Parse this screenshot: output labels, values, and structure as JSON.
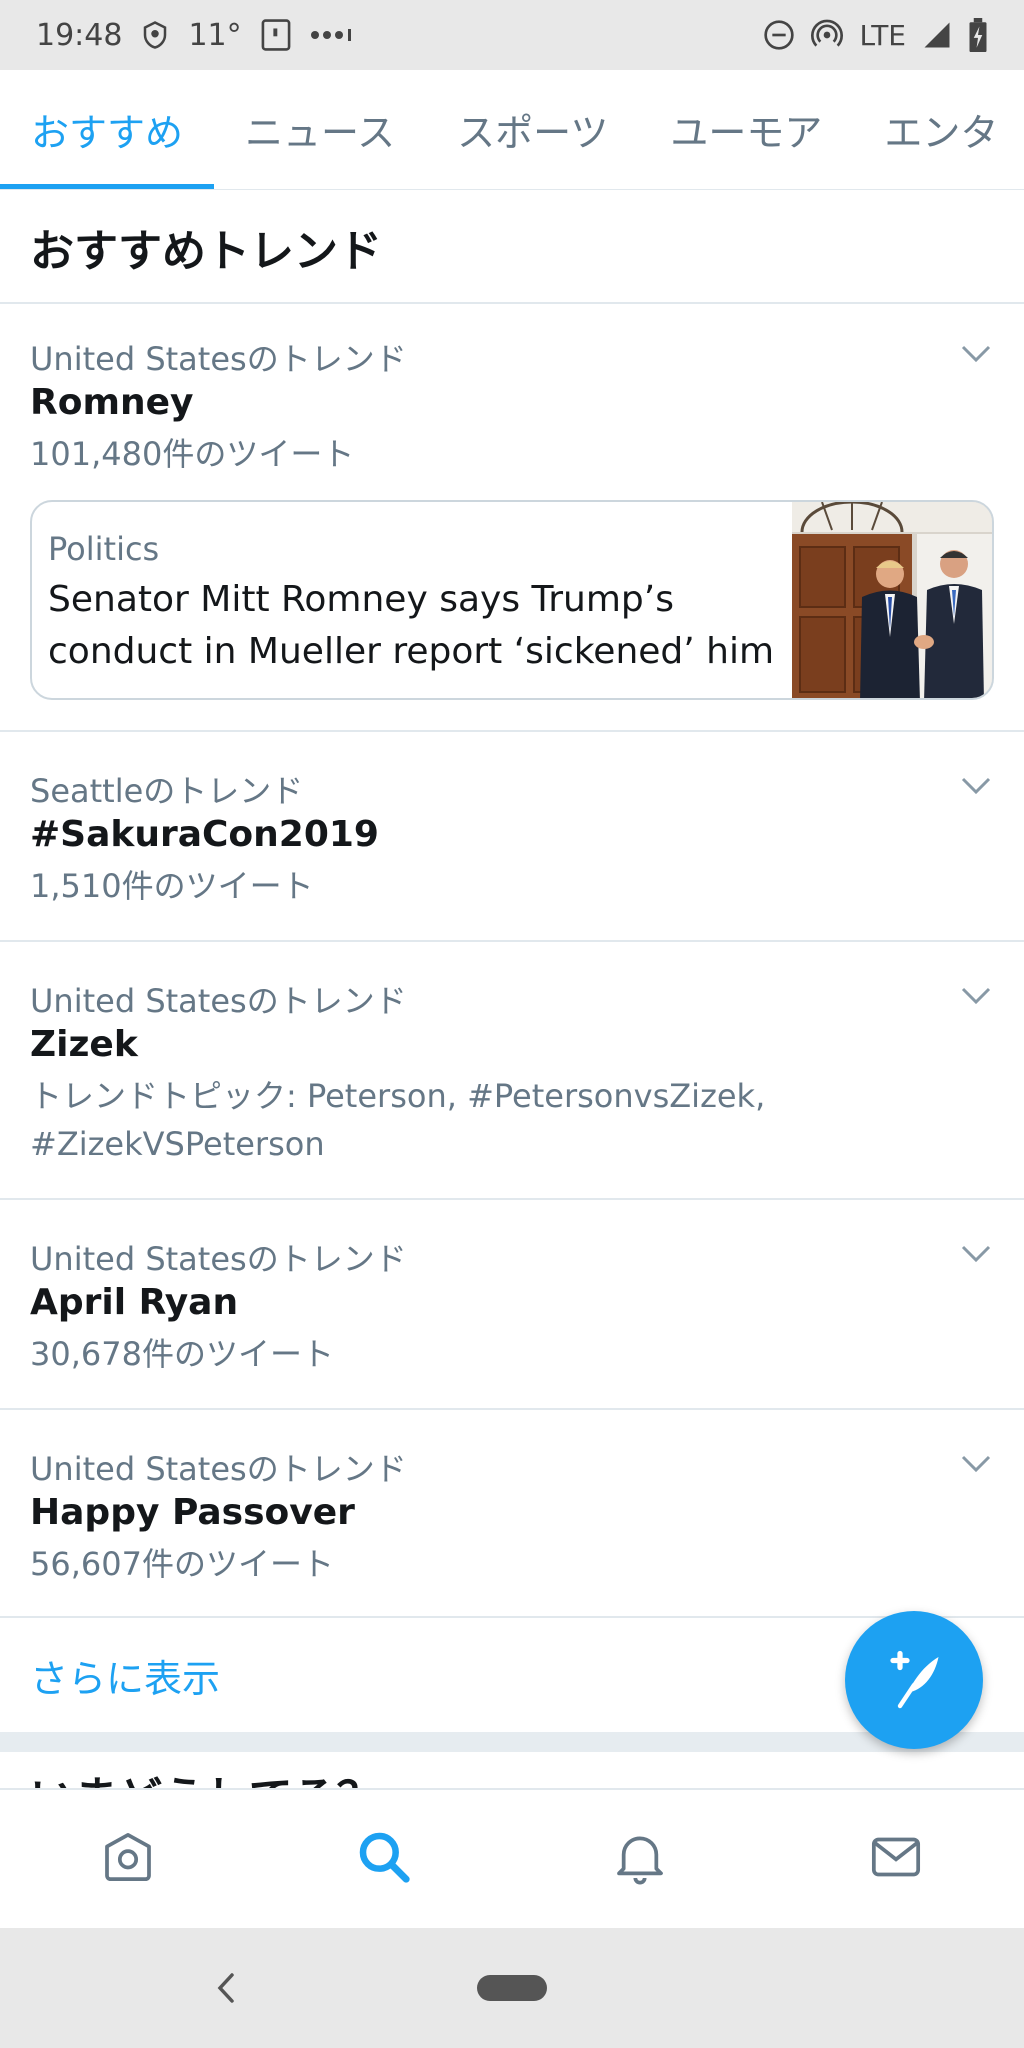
{
  "status_bar": {
    "time": "19:48",
    "temperature": "11°",
    "network": "LTE"
  },
  "tabs": [
    {
      "label": "おすすめ",
      "active": true
    },
    {
      "label": "ニュース",
      "active": false
    },
    {
      "label": "スポーツ",
      "active": false
    },
    {
      "label": "ユーモア",
      "active": false
    },
    {
      "label": "エンタ",
      "active": false
    }
  ],
  "section_title": "おすすめトレンド",
  "trends": [
    {
      "context": "United Statesのトレンド",
      "name": "Romney",
      "meta": "101,480件のツイート",
      "news": {
        "category": "Politics",
        "headline": "Senator Mitt Romney says Trump’s conduct in Mueller report ‘sickened’ him"
      }
    },
    {
      "context": "Seattleのトレンド",
      "name": "#SakuraCon2019",
      "meta": "1,510件のツイート"
    },
    {
      "context": "United Statesのトレンド",
      "name": "Zizek",
      "meta": "トレンドトピック: Peterson, #PetersonvsZizek, #ZizekVSPeterson"
    },
    {
      "context": "United Statesのトレンド",
      "name": "April Ryan",
      "meta": "30,678件のツイート"
    },
    {
      "context": "United Statesのトレンド",
      "name": "Happy Passover",
      "meta": "56,607件のツイート"
    }
  ],
  "show_more": "さらに表示",
  "next_section_partial": "いまどうしてる？",
  "bottom_nav": [
    {
      "icon": "home-icon",
      "active": false
    },
    {
      "icon": "search-icon",
      "active": true
    },
    {
      "icon": "notifications-icon",
      "active": false
    },
    {
      "icon": "messages-icon",
      "active": false
    }
  ],
  "colors": {
    "accent": "#1da1f2",
    "text_primary": "#14171a",
    "text_secondary": "#657786",
    "divider": "#e1e8ed"
  }
}
